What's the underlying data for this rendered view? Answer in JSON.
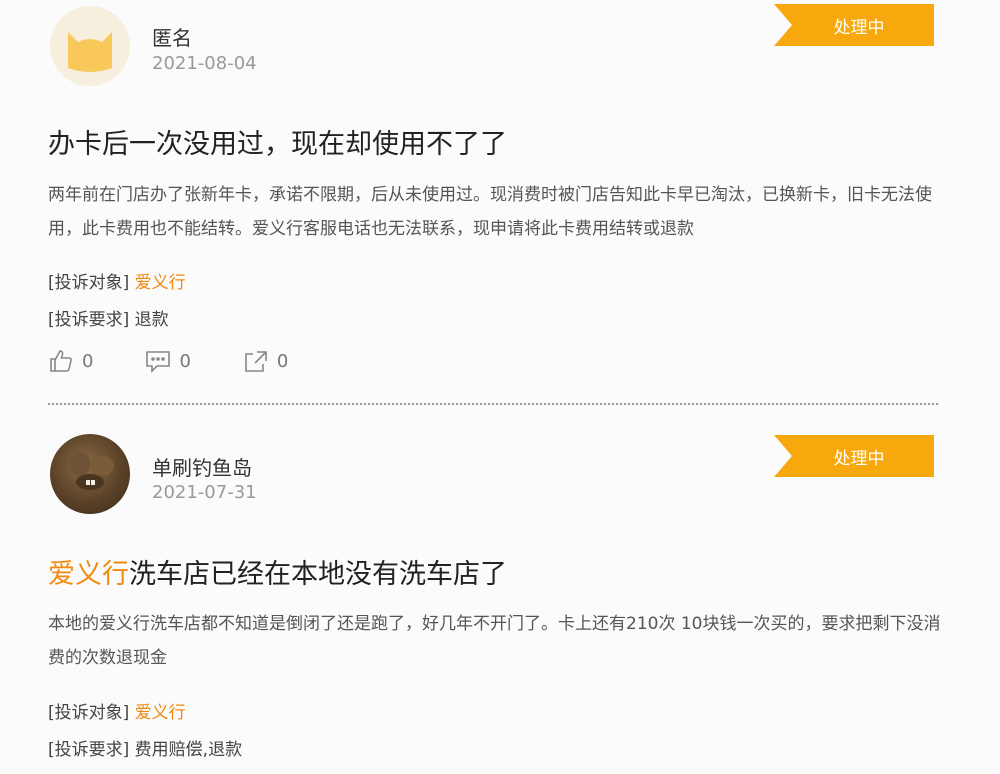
{
  "posts": [
    {
      "user": "匿名",
      "date": "2021-08-04",
      "status": "处理中",
      "title": "办卡后一次没用过，现在却使用不了了",
      "content": "两年前在门店办了张新年卡，承诺不限期，后从未使用过。现消费时被门店告知此卡早已淘汰，已换新卡，旧卡无法使用，此卡费用也不能结转。爱义行客服电话也无法联系，现申请将此卡费用结转或退款",
      "target_label": "[投诉对象]",
      "target_value": "爱义行",
      "request_label": "[投诉要求]",
      "request_value": "退款",
      "likes": "0",
      "comments": "0",
      "shares": "0"
    },
    {
      "user": "单刷钓鱼岛",
      "date": "2021-07-31",
      "status": "处理中",
      "title_highlight": "爱义行",
      "title_rest": "洗车店已经在本地没有洗车店了",
      "content": "本地的爱义行洗车店都不知道是倒闭了还是跑了，好几年不开门了。卡上还有210次 10块钱一次买的，要求把剩下没消费的次数退现金",
      "target_label": "[投诉对象]",
      "target_value": "爱义行",
      "request_label": "[投诉要求]",
      "request_value": "费用赔偿,退款"
    }
  ],
  "colors": {
    "accent": "#f7a80d",
    "highlight": "#f08a10"
  },
  "icons": [
    "thumbs-up-icon",
    "comment-icon",
    "share-icon",
    "cat-avatar-icon"
  ]
}
